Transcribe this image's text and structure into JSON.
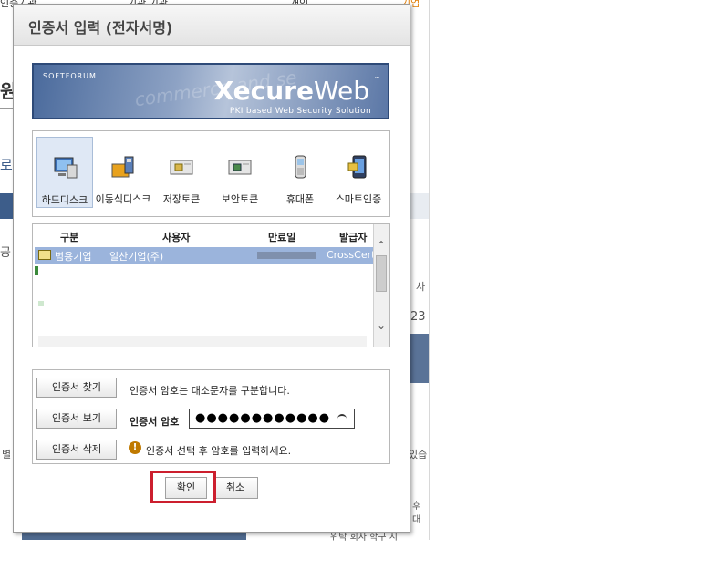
{
  "background_page": {
    "top_nav": [
      "인증기관",
      "기관 기관",
      "개인",
      "기업"
    ],
    "fragments": [
      "원",
      "로",
      "공",
      "사",
      "23",
      "별",
      "있습",
      "후대",
      "위탁 회사 학구 시"
    ]
  },
  "dialog": {
    "title": "인증서 입력 (전자서명)",
    "banner": {
      "sub_brand": "SOFTFORUM",
      "brand_bold": "Xecure",
      "brand_thin": "Web",
      "trademark": "™",
      "tagline": "PKI based Web Security Solution",
      "ghost_text": "commerce and se"
    },
    "storage_options": [
      {
        "label": "하드디스크",
        "icon": "hard-disk-icon",
        "selected": true
      },
      {
        "label": "이동식디스크",
        "icon": "removable-disk-icon",
        "selected": false
      },
      {
        "label": "저장토큰",
        "icon": "storage-token-icon",
        "selected": false
      },
      {
        "label": "보안토큰",
        "icon": "security-token-icon",
        "selected": false
      },
      {
        "label": "휴대폰",
        "icon": "mobile-phone-icon",
        "selected": false
      },
      {
        "label": "스마트인증",
        "icon": "smart-auth-icon",
        "selected": false
      }
    ],
    "cert_table": {
      "headers": [
        "구분",
        "사용자",
        "만료일",
        "발급자"
      ],
      "selected_row": {
        "type": "범용기업",
        "user": "일산기업(주)",
        "expiry": "",
        "issuer": "CrossCertC"
      }
    },
    "actions": {
      "find_cert": "인증서 찾기",
      "view_cert": "인증서 보기",
      "delete_cert": "인증서 삭제"
    },
    "case_notice": "인증서 암호는 대소문자를 구분합니다.",
    "password_label": "인증서 암호",
    "password_value": "●●●●●●●●●●●●",
    "hint": "인증서 선택 후 암호를 입력하세요.",
    "ok_label": "확인",
    "cancel_label": "취소"
  },
  "colors": {
    "highlight": "#cc1f2e",
    "selected_row": "#9bb4dc",
    "banner": "#4a6a9c"
  }
}
